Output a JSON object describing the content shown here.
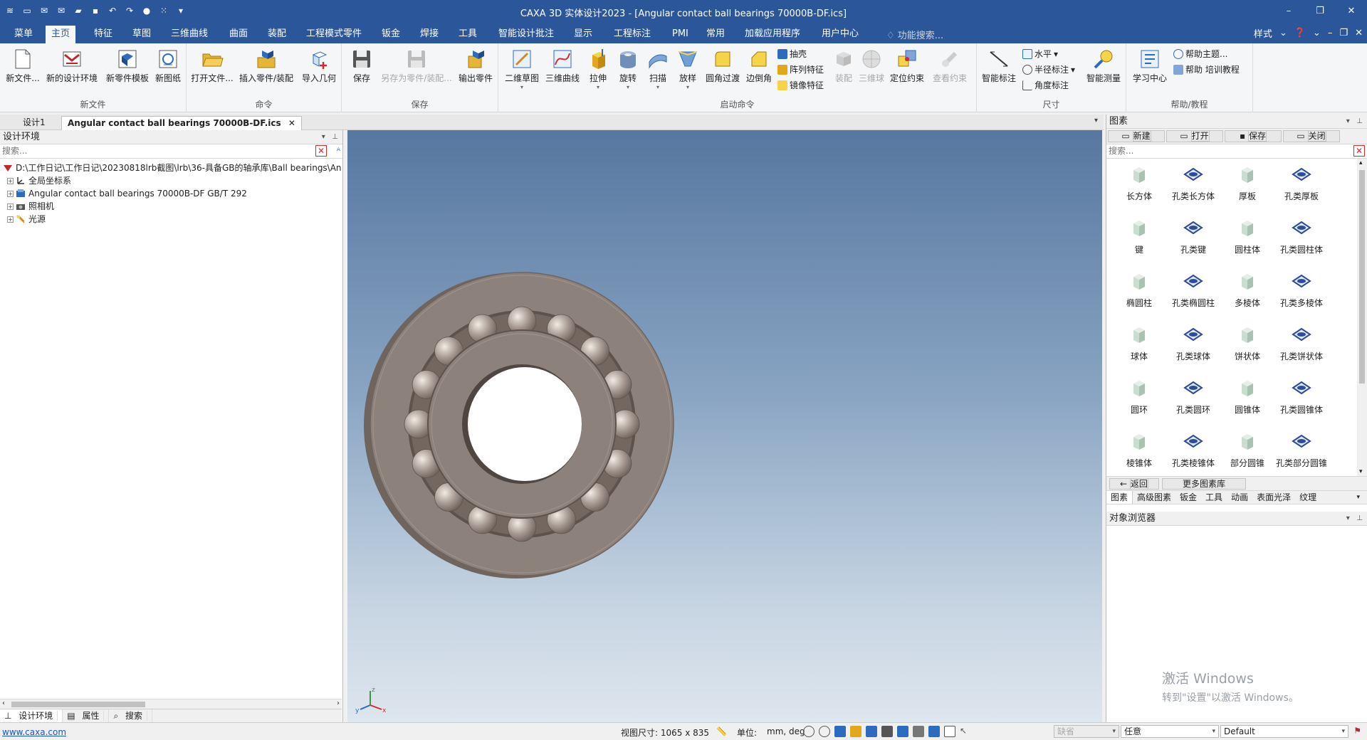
{
  "window": {
    "title": "CAXA 3D 实体设计2023 - [Angular contact ball bearings 70000B-DF.ics]",
    "controls": [
      "–",
      "❐",
      "✕"
    ]
  },
  "menubar": {
    "tabs": [
      "菜单",
      "主页",
      "特征",
      "草图",
      "三维曲线",
      "曲面",
      "装配",
      "工程模式零件",
      "钣金",
      "焊接",
      "工具",
      "智能设计批注",
      "显示",
      "工程标注",
      "PMI",
      "常用",
      "加载应用程序",
      "用户中心"
    ],
    "active_tab": "主页",
    "function_search": "功能搜索...",
    "style_label": "样式",
    "mdi_controls": [
      "–",
      "❐",
      "✕"
    ]
  },
  "ribbon": {
    "groups": {
      "new_file": "新文件",
      "command": "命令",
      "save": "保存",
      "start_command": "启动命令",
      "dimension": "尺寸",
      "help": "帮助/教程"
    },
    "buttons": {
      "new_file": "新文件...",
      "new_design_env": "新的设计环境",
      "new_part_template": "新零件模板",
      "new_drawing": "新图纸",
      "open_file": "打开文件...",
      "insert_part": "插入零件/装配",
      "import_geometry": "导入几何",
      "save": "保存",
      "save_as_part": "另存为零件/装配...",
      "export_part": "输出零件",
      "sketch_2d": "二维草图",
      "curve_3d": "三维曲线",
      "extrude": "拉伸",
      "revolve": "旋转",
      "sweep": "扫描",
      "loft": "放样",
      "fillet": "圆角过渡",
      "chamfer": "边倒角",
      "shell": "抽壳",
      "pattern": "阵列特征",
      "mirror": "镜像特征",
      "assembly": "装配",
      "ball_3d": "三维球",
      "position_constraint": "定位约束",
      "view_constraint": "查看约束",
      "smart_dimension": "智能标注",
      "horizontal": "水平",
      "radius_dimension": "半径标注",
      "angle_dimension": "角度标注",
      "smart_measure": "智能测量",
      "learning_center": "学习中心",
      "help_topics": "帮助主题...",
      "training": "帮助 培训教程"
    }
  },
  "doc_tabs": [
    "设计1",
    "Angular contact ball bearings 70000B-DF.ics"
  ],
  "left_panel": {
    "title": "设计环境",
    "search_placeholder": "搜索...",
    "tree": [
      "D:\\工作日记\\工作日记\\20230818lrb截图\\lrb\\36-具备GB的轴承库\\Ball bearings\\An",
      "全局坐标系",
      "Angular contact ball bearings 70000B-DF GB/T 292",
      "照相机",
      "光源"
    ],
    "bottom_tabs": [
      "设计环境",
      "属性",
      "搜索"
    ]
  },
  "right_panel": {
    "title": "图素",
    "lib_buttons": [
      "新建",
      "打开",
      "保存",
      "关闭"
    ],
    "search_placeholder": "搜索...",
    "gallery": [
      "长方体",
      "孔类长方体",
      "厚板",
      "孔类厚板",
      "键",
      "孔类键",
      "圆柱体",
      "孔类圆柱体",
      "椭圆柱",
      "孔类椭圆柱",
      "多棱体",
      "孔类多棱体",
      "球体",
      "孔类球体",
      "饼状体",
      "孔类饼状体",
      "圆环",
      "孔类圆环",
      "圆锥体",
      "孔类圆锥体",
      "棱锥体",
      "孔类棱锥体",
      "部分圆锥",
      "孔类部分圆锥"
    ],
    "back_label": "返回",
    "more_label": "更多图素库",
    "category_tabs": [
      "图素",
      "高级图素",
      "钣金",
      "工具",
      "动画",
      "表面光泽",
      "纹理"
    ],
    "browser_title": "对象浏览器",
    "watermark_1": "激活 Windows",
    "watermark_2": "转到\"设置\"以激活 Windows。"
  },
  "viewport": {
    "axis_x": "x",
    "axis_y": "y",
    "axis_z": "z"
  },
  "statusbar": {
    "link": "www.caxa.com",
    "view_size_label": "视图尺寸: 1065 x  835",
    "unit_label": "单位:",
    "unit_value": "mm, deg",
    "filter_placeholder": "缺省",
    "select_mode": "任意",
    "style": "Default"
  },
  "colors": {
    "titlebar": "#2b579a",
    "ribbon_bg": "#f5f6f7",
    "bearing": "#8d817b",
    "viewport_top": "#5777a0",
    "viewport_bottom": "#dee6ee"
  }
}
